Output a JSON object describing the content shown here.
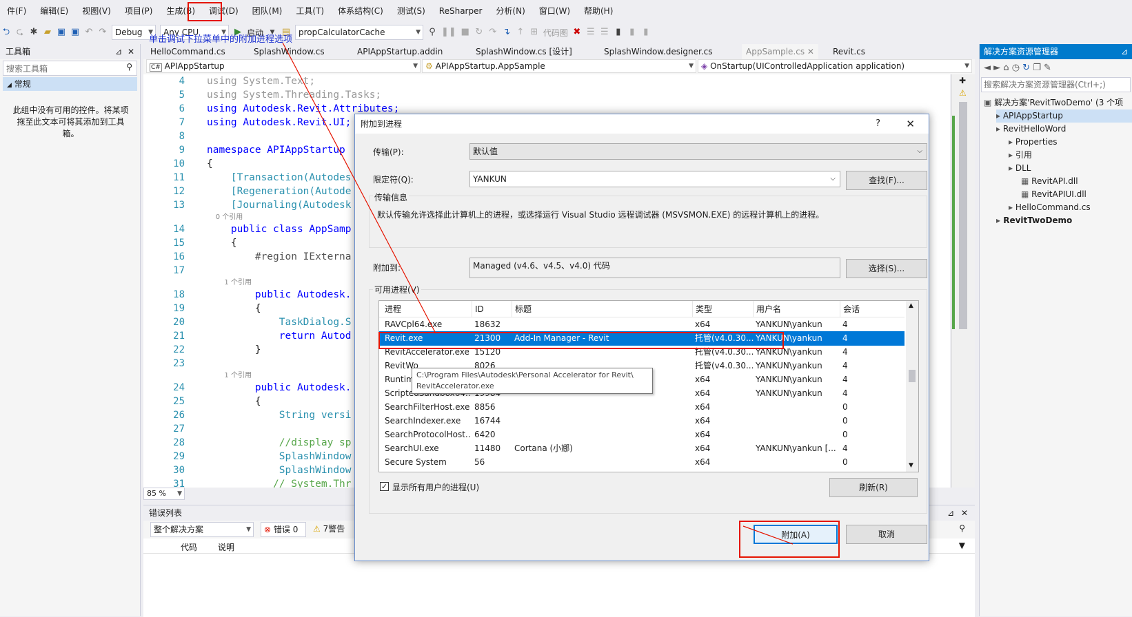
{
  "menu": [
    "件(F)",
    "编辑(E)",
    "视图(V)",
    "项目(P)",
    "生成(B)",
    "调试(D)",
    "团队(M)",
    "工具(T)",
    "体系结构(C)",
    "测试(S)",
    "ReSharper",
    "分析(N)",
    "窗口(W)",
    "帮助(H)"
  ],
  "toolbar": {
    "config": "Debug",
    "platform": "Any CPU",
    "start": "启动",
    "target": "propCalculatorCache",
    "code_map": "代码图"
  },
  "annotation": "单击调试下拉菜单中的附加进程选项",
  "toolbox": {
    "title": "工具箱",
    "search_placeholder": "搜索工具箱",
    "group": "常规",
    "empty_text": "此组中没有可用的控件。将某项拖至此文本可将其添加到工具箱。"
  },
  "tabs": [
    "HelloCommand.cs",
    "SplashWindow.cs",
    "APIAppStartup.addin",
    "SplashWindow.cs [设计]",
    "SplashWindow.designer.cs",
    "AppSample.cs",
    "Revit.cs"
  ],
  "nav": {
    "project": "APIAppStartup",
    "class": "APIAppStartup.AppSample",
    "member": "OnStartup(UIControlledApplication application)"
  },
  "code": [
    {
      "n": "4",
      "t": "using System.Text;",
      "fade": true
    },
    {
      "n": "5",
      "t": "using System.Threading.Tasks;",
      "fade": true
    },
    {
      "n": "6",
      "t": "using Autodesk.Revit.Attributes;"
    },
    {
      "n": "7",
      "t": "using Autodesk.Revit.UI;"
    },
    {
      "n": "8",
      "t": ""
    },
    {
      "n": "9",
      "t": "namespace APIAppStartup"
    },
    {
      "n": "10",
      "t": "{"
    },
    {
      "n": "11",
      "t": "    [Transaction(Autodes"
    },
    {
      "n": "12",
      "t": "    [Regeneration(Autode"
    },
    {
      "n": "13",
      "t": "    [Journaling(Autodesk"
    },
    {
      "n": "",
      "t": "    0 个引用",
      "small": true
    },
    {
      "n": "14",
      "t": "    public class AppSamp"
    },
    {
      "n": "15",
      "t": "    {"
    },
    {
      "n": "16",
      "t": "        #region IExterna"
    },
    {
      "n": "17",
      "t": ""
    },
    {
      "n": "",
      "t": "        1 个引用",
      "small": true
    },
    {
      "n": "18",
      "t": "        public Autodesk."
    },
    {
      "n": "19",
      "t": "        {"
    },
    {
      "n": "20",
      "t": "            TaskDialog.S"
    },
    {
      "n": "21",
      "t": "            return Autod"
    },
    {
      "n": "22",
      "t": "        }"
    },
    {
      "n": "23",
      "t": ""
    },
    {
      "n": "",
      "t": "        1 个引用",
      "small": true
    },
    {
      "n": "24",
      "t": "        public Autodesk."
    },
    {
      "n": "25",
      "t": "        {"
    },
    {
      "n": "26",
      "t": "            String versi"
    },
    {
      "n": "27",
      "t": ""
    },
    {
      "n": "28",
      "t": "            //display sp"
    },
    {
      "n": "29",
      "t": "            SplashWindow"
    },
    {
      "n": "30",
      "t": "            SplashWindow"
    },
    {
      "n": "31",
      "t": "           // System.Thr"
    }
  ],
  "zoom": "85 %",
  "errors": {
    "title": "错误列表",
    "scope": "整个解决方案",
    "errors": "错误 0",
    "warnings": "7警告 0",
    "col_code": "代码",
    "col_desc": "说明"
  },
  "solution": {
    "title": "解决方案资源管理器",
    "search_placeholder": "搜索解决方案资源管理器(Ctrl+;)",
    "items": [
      {
        "label": "解决方案'RevitTwoDemo' (3 个项",
        "level": 0
      },
      {
        "label": "APIAppStartup",
        "level": 1,
        "sel": true
      },
      {
        "label": "RevitHelloWord",
        "level": 1
      },
      {
        "label": "Properties",
        "level": 2
      },
      {
        "label": "引用",
        "level": 2
      },
      {
        "label": "DLL",
        "level": 2
      },
      {
        "label": "RevitAPI.dll",
        "level": 3
      },
      {
        "label": "RevitAPIUI.dll",
        "level": 3
      },
      {
        "label": "HelloCommand.cs",
        "level": 2
      },
      {
        "label": "RevitTwoDemo",
        "level": 1,
        "bold": true
      }
    ]
  },
  "dialog": {
    "title": "附加到进程",
    "help": "?",
    "transport_label": "传输(P):",
    "transport_value": "默认值",
    "qualifier_label": "限定符(Q):",
    "qualifier_value": "YANKUN",
    "find_button": "查找(F)...",
    "info_group": "传输信息",
    "info_text": "默认传输允许选择此计算机上的进程，或选择运行 Visual Studio 远程调试器 (MSVSMON.EXE) 的远程计算机上的进程。",
    "attach_to_label": "附加到:",
    "attach_to_value": "Managed (v4.6、v4.5、v4.0) 代码",
    "select_button": "选择(S)...",
    "processes_group": "可用进程(V)",
    "columns": [
      "进程",
      "ID",
      "标题",
      "类型",
      "用户名",
      "会话"
    ],
    "rows": [
      [
        "RAVCpl64.exe",
        "18632",
        "",
        "x64",
        "YANKUN\\yankun",
        "4"
      ],
      [
        "Revit.exe",
        "21300",
        "Add-In Manager - Revit",
        "托管(v4.0.30...",
        "YANKUN\\yankun",
        "4"
      ],
      [
        "RevitAccelerator.exe",
        "15120",
        "",
        "托管(v4.0.30...",
        "YANKUN\\yankun",
        "4"
      ],
      [
        "RevitWo",
        "8026",
        "",
        "托管(v4.0.30...",
        "YANKUN\\yankun",
        "4"
      ],
      [
        "Runtim",
        "",
        "",
        "x64",
        "YANKUN\\yankun",
        "4"
      ],
      [
        "ScriptedSandbox64....",
        "19984",
        "",
        "x64",
        "YANKUN\\yankun",
        "4"
      ],
      [
        "SearchFilterHost.exe",
        "8856",
        "",
        "x64",
        "",
        "0"
      ],
      [
        "SearchIndexer.exe",
        "16744",
        "",
        "x64",
        "",
        "0"
      ],
      [
        "SearchProtocolHost....",
        "6420",
        "",
        "x64",
        "",
        "0"
      ],
      [
        "SearchUI.exe",
        "11480",
        "Cortana (小娜)",
        "x64",
        "YANKUN\\yankun [...",
        "4"
      ],
      [
        "Secure System",
        "56",
        "",
        "x64",
        "",
        "0"
      ]
    ],
    "tooltip": "C:\\Program Files\\Autodesk\\Personal Accelerator for Revit\\\nRevitAccelerator.exe",
    "show_all_label": "显示所有用户的进程(U)",
    "refresh_button": "刷新(R)",
    "attach_button": "附加(A)",
    "cancel_button": "取消"
  }
}
